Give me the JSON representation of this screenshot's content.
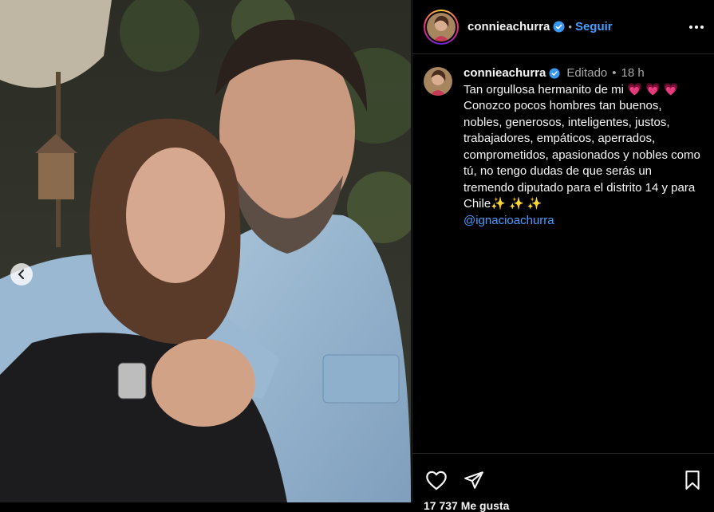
{
  "post": {
    "username": "connieachurra",
    "follow_label": "Seguir",
    "separator": "•",
    "edited_label": "Editado",
    "time_ago": "18 h",
    "caption_text": "Tan orgullosa hermanito de mi ",
    "caption_line2": "Conozco pocos hombres tan buenos, nobles, generosos, inteligentes, justos, trabajadores, empáticos, aperrados, comprometidos, apasionados y nobles como tú, no tengo dudas de que serás un tremendo diputado para el distrito 14 y para Chile",
    "hearts": "💗 💗 💗",
    "sparkles": "✨ ✨ ✨",
    "mention": "@ignacioachurra",
    "likes_partial": "17 737 Me gusta"
  },
  "icons": {
    "verified": "verified-badge-icon",
    "more": "more-options-icon",
    "like": "heart-icon",
    "share": "share-icon",
    "save": "bookmark-icon",
    "prev": "chevron-left-icon"
  },
  "colors": {
    "link_blue": "#4a9dff",
    "verified_blue": "#3897f0",
    "muted": "#a8a8a8"
  }
}
